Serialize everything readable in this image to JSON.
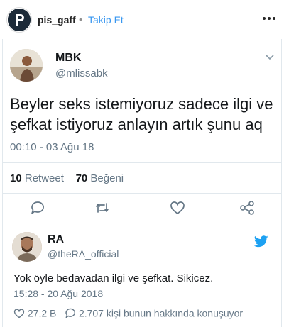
{
  "instagram_header": {
    "username": "pis_gaff",
    "separator": "•",
    "follow_label": "Takip Et",
    "more_icon": "more-horizontal-icon"
  },
  "tweet": {
    "name": "MBK",
    "handle": "@mlissabk",
    "text": "Beyler seks istemiyoruz sadece ilgi ve şefkat istiyoruz anlayın artık şunu aq",
    "timestamp": "00:10 - 03 Ağu 18",
    "retweet_count": "10",
    "retweet_label": "Retweet",
    "like_count": "70",
    "like_label": "Beğeni",
    "actions": [
      "reply-icon",
      "retweet-icon",
      "heart-icon",
      "share-icon"
    ]
  },
  "reply": {
    "name": "RA",
    "handle": "@theRA_official",
    "text": "Yok öyle bedavadan ilgi ve şefkat. Sikicez.",
    "timestamp": "15:28 - 20 Ağu 2018",
    "likes": "27,2 B",
    "comments_text": "2.707 kişi bunun hakkında konuşuyor"
  },
  "colors": {
    "twitter_blue": "#1da1f2",
    "instagram_link": "#3897f0",
    "secondary_text": "#657786"
  }
}
